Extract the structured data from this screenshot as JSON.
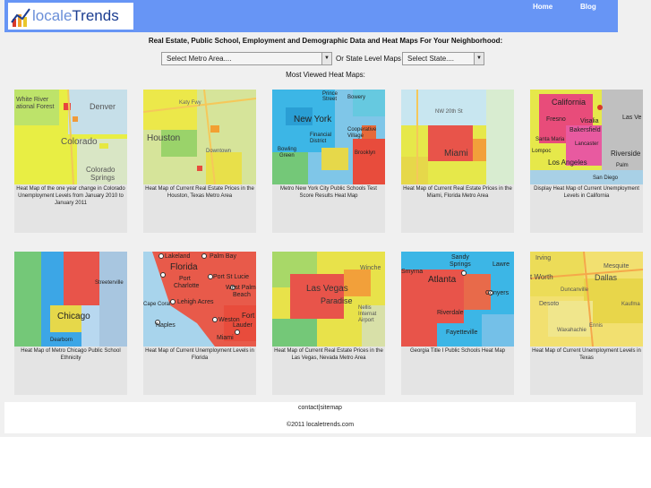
{
  "brand": {
    "name_part1": "locale",
    "name_part2": "Trends",
    "color_light": "#6a8fd8",
    "color_dark": "#1b3d91"
  },
  "nav": {
    "home": "Home",
    "blog": "Blog"
  },
  "tagline": "Real Estate, Public School, Employment and Demographic Data and Heat Maps For Your Neighborhood:",
  "selectors": {
    "metro": "Select Metro Area....",
    "or_label": "Or State Level Maps",
    "state": "Select State...."
  },
  "most_viewed": "Most Viewed Heat Maps:",
  "cards": [
    {
      "caption": "Heat Map of the one year change in Colorado Unemployment Levels from January 2010 to January 2011",
      "map_labels": [
        "White River",
        "ational Forest",
        "Denver",
        "Colorado",
        "Colorado",
        "Springs"
      ]
    },
    {
      "caption": "Heat Map of Current Real Estate Prices in the Houston, Texas Metro Area",
      "map_labels": [
        "Katy Fwy",
        "Houston",
        "Downtown"
      ]
    },
    {
      "caption": "Metro New York City Public Schools Test Score Results Heat Map",
      "map_labels": [
        "Prince",
        "Street",
        "Bowery",
        "New York",
        "Financial",
        "District",
        "Cooperative",
        "Village",
        "Bowling",
        "Green",
        "Brooklyn"
      ]
    },
    {
      "caption": "Heat Map of Current Real Estate Prices in the Miami, Florida Metro Area",
      "map_labels": [
        "NW 20th St",
        "Miami"
      ]
    },
    {
      "caption": "Display Heat Map of Current Unemployment Levels in California",
      "map_labels": [
        "California",
        "Fresno",
        "Visalia",
        "Las Ve",
        "Bakersfield",
        "Santa Maria",
        "Lompoc",
        "Riverside",
        "Los Angeles",
        "Lancaster",
        "Palm",
        "San Diego"
      ]
    },
    {
      "caption": "Heat Map of Metro Chicago Public School Ethnicity",
      "map_labels": [
        "Streeterville",
        "Chicago",
        "Dearborn"
      ]
    },
    {
      "caption": "Heat Map of Current Unemployment Levels in Florida",
      "map_labels": [
        "Lakeland",
        "Palm Bay",
        "Florida",
        "Port St Lucie",
        "Port",
        "Charlotte",
        "West Palm",
        "Beach",
        "Lehigh Acres",
        "Cape Coral",
        "Naples",
        "Weston",
        "Fort",
        "Lauder",
        "Miami"
      ]
    },
    {
      "caption": "Heat Map of Current Real Estate Prices in the Las Vegas, Nevada Metro Area",
      "map_labels": [
        "Las Vegas",
        "Paradise",
        "Winche",
        "Nellis",
        "Internat",
        "Airport"
      ]
    },
    {
      "caption": "Georgia Title I Public Schools Heat Map",
      "map_labels": [
        "Sandy",
        "Springs",
        "Smyrna",
        "Lawre",
        "Atlanta",
        "Conyers",
        "Riverdale",
        "Fayetteville"
      ]
    },
    {
      "caption": "Heat Map of Current Unemployment Levels in Texas",
      "map_labels": [
        "Irving",
        "Mesquite",
        "Dallas",
        "t Worth",
        "Duncanville",
        "Desoto",
        "Waxahachie",
        "Ennis",
        "Kaufma"
      ]
    }
  ],
  "footer": {
    "contact": "contact",
    "separator": "|",
    "sitemap": "sitemap",
    "copyright": "©2011 localetrends.com"
  }
}
